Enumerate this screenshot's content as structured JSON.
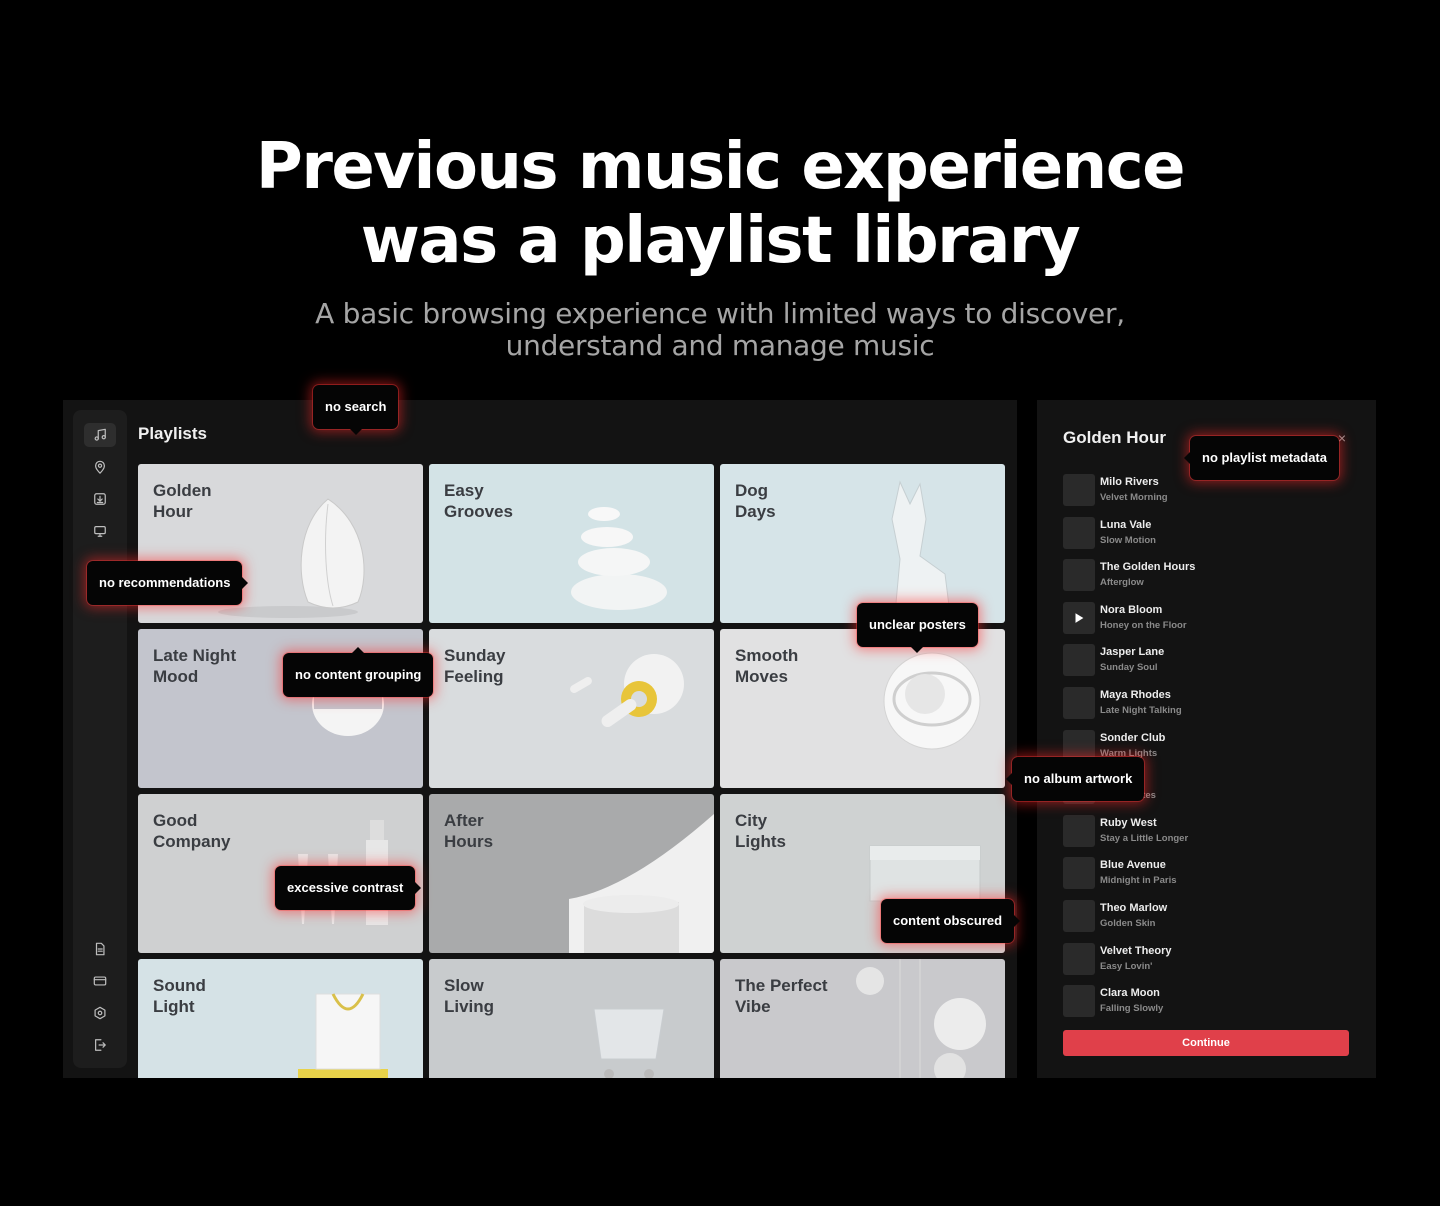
{
  "hero": {
    "title_line1": "Previous music experience",
    "title_line2": "was a playlist library",
    "subtitle_line1": "A basic browsing experience with limited ways to discover,",
    "subtitle_line2": "understand and manage music"
  },
  "sidebar": {
    "top_icons": [
      "music-note-icon",
      "location-pin-icon",
      "download-icon",
      "monitor-icon"
    ],
    "bottom_icons": [
      "document-icon",
      "credit-card-icon",
      "settings-icon",
      "logout-icon"
    ]
  },
  "main": {
    "title": "Playlists",
    "playlists": [
      {
        "label": "Golden\nHour",
        "bg": "#d8d9db",
        "art": "vase"
      },
      {
        "label": "Easy\nGrooves",
        "bg": "#d3e3e6",
        "art": "stones"
      },
      {
        "label": "Dog\nDays",
        "bg": "#d6e4e8",
        "art": "dog"
      },
      {
        "label": "Late Night\nMood",
        "bg": "#c3c5cd",
        "art": "disc"
      },
      {
        "label": "Sunday\nFeeling",
        "bg": "#d9dcde",
        "art": "ring"
      },
      {
        "label": "Smooth\nMoves",
        "bg": "#e1e1e2",
        "art": "sphere"
      },
      {
        "label": "Good\nCompany",
        "bg": "#cfd0d1",
        "art": "bottle"
      },
      {
        "label": "After\nHours",
        "bg": "#a9aaab",
        "art": "arch"
      },
      {
        "label": "City\nLights",
        "bg": "#cfd2d2",
        "art": "box"
      },
      {
        "label": "Sound\nLight",
        "bg": "#d5e2e6",
        "art": "bag"
      },
      {
        "label": "Slow\nLiving",
        "bg": "#c8cbcd",
        "art": "cart"
      },
      {
        "label": "The Perfect\nVibe",
        "bg": "#c9c9cc",
        "art": "orbs"
      }
    ]
  },
  "panel": {
    "title": "Golden Hour",
    "close": "×",
    "tracks": [
      {
        "artist": "Milo Rivers",
        "song": "Velvet Morning"
      },
      {
        "artist": "Luna Vale",
        "song": "Slow Motion"
      },
      {
        "artist": "The Golden Hours",
        "song": "Afterglow"
      },
      {
        "artist": "Nora Bloom",
        "song": "Honey on the Floor",
        "playing": true
      },
      {
        "artist": "Jasper Lane",
        "song": "Sunday Soul"
      },
      {
        "artist": "Maya Rhodes",
        "song": "Late Night Talking"
      },
      {
        "artist": "Sonder Club",
        "song": "Warm Lights"
      },
      {
        "artist": "…ne",
        "song": "…Cigarettes"
      },
      {
        "artist": "Ruby West",
        "song": "Stay a Little Longer"
      },
      {
        "artist": "Blue Avenue",
        "song": "Midnight in Paris"
      },
      {
        "artist": "Theo Marlow",
        "song": "Golden Skin"
      },
      {
        "artist": "Velvet Theory",
        "song": "Easy Lovin'"
      },
      {
        "artist": "Clara Moon",
        "song": "Falling Slowly"
      }
    ],
    "continue_label": "Continue"
  },
  "annotations": {
    "no_search": "no search",
    "no_metadata": "no playlist metadata",
    "no_recommendations": "no recommendations",
    "unclear_posters": "unclear posters",
    "no_grouping": "no content grouping",
    "no_artwork": "no album artwork",
    "excessive_contrast": "excessive contrast",
    "content_obscured": "content obscured"
  },
  "colors": {
    "accent": "#e0404a",
    "background": "#000000",
    "surface": "#131313"
  }
}
